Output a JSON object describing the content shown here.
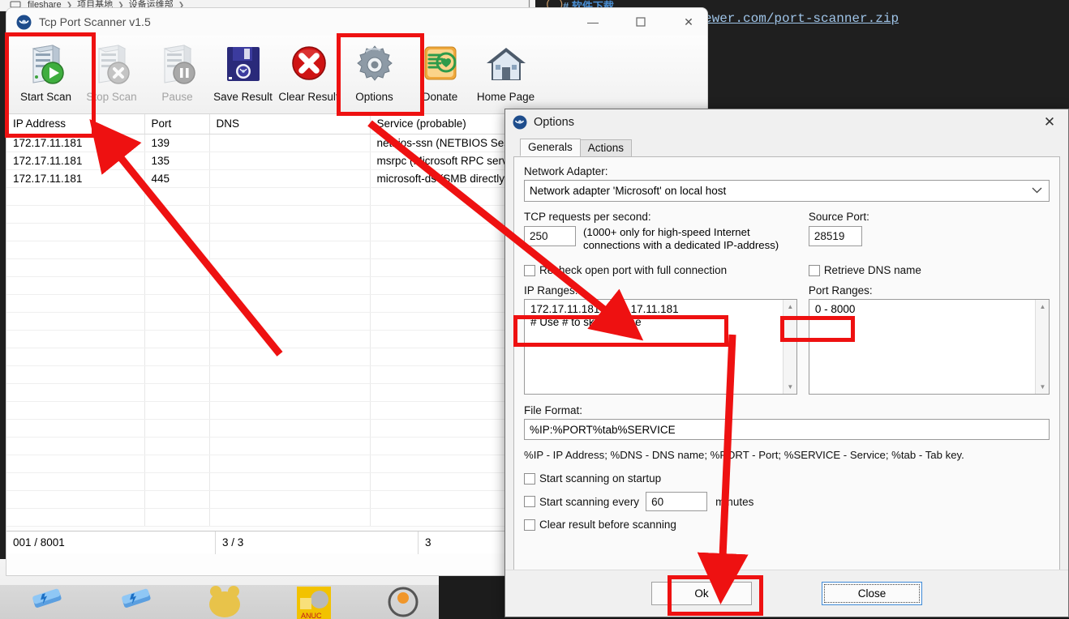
{
  "background": {
    "explorer_breadcrumb": [
      "fileshare",
      "项目基地",
      "设备运维部"
    ],
    "dark_heading_hash": "#",
    "dark_heading_text": "软件下载",
    "zip_link": "ewer.com/port-scanner.zip"
  },
  "app": {
    "title": "Tcp Port Scanner v1.5",
    "window_controls": {
      "minimize": "—",
      "maximize": "▢",
      "close": "✕"
    },
    "toolbar": [
      {
        "label": "Start Scan",
        "icon": "server-play-icon",
        "disabled": false
      },
      {
        "label": "Stop Scan",
        "icon": "server-stop-icon",
        "disabled": true
      },
      {
        "label": "Pause",
        "icon": "server-pause-icon",
        "disabled": true
      },
      {
        "label": "Save Result",
        "icon": "floppy-disk-icon",
        "disabled": false
      },
      {
        "label": "Clear Result",
        "icon": "red-x-icon",
        "disabled": false
      },
      {
        "label": "Options",
        "icon": "gear-icon",
        "disabled": false
      },
      {
        "label": "Donate",
        "icon": "donate-hand-icon",
        "disabled": false
      },
      {
        "label": "Home Page",
        "icon": "house-icon",
        "disabled": false
      }
    ],
    "table": {
      "columns": [
        "IP Address",
        "Port",
        "DNS",
        "Service (probable)"
      ],
      "rows": [
        [
          "172.17.11.181",
          "139",
          "",
          "netbios-ssn (NETBIOS Sess"
        ],
        [
          "172.17.11.181",
          "135",
          "",
          "msrpc (Microsoft RPC servi"
        ],
        [
          "172.17.11.181",
          "445",
          "",
          "microsoft-ds (SMB directly "
        ]
      ],
      "empty_rows": 19
    },
    "statusbar": {
      "progress": "001 / 8001",
      "hosts": "3 / 3",
      "count": "3"
    }
  },
  "options_dialog": {
    "title": "Options",
    "close_label": "✕",
    "tabs": [
      {
        "label": "Generals",
        "active": true
      },
      {
        "label": "Actions",
        "active": false
      }
    ],
    "network_adapter": {
      "label": "Network Adapter:",
      "value": "Network adapter 'Microsoft' on local host",
      "chevron": "⌄"
    },
    "tcp_requests": {
      "label": "TCP requests per second:",
      "value": "250",
      "note_line1": "(1000+ only for high-speed Internet",
      "note_line2": "connections with a dedicated IP-address)"
    },
    "source_port": {
      "label": "Source Port:",
      "value": "28519"
    },
    "recheck_checkbox": {
      "label": "Recheck open port with full connection",
      "checked": false
    },
    "retrieve_dns_checkbox": {
      "label": "Retrieve DNS name",
      "checked": false
    },
    "ip_ranges": {
      "label": "IP Ranges:",
      "line1": "172.17.11.181 - 172.17.11.181",
      "line2": "# Use # to skip the line"
    },
    "port_ranges": {
      "label": "Port Ranges:",
      "line1": "0 - 8000"
    },
    "file_format": {
      "label": "File Format:",
      "value": "%IP:%PORT%tab%SERVICE"
    },
    "format_hint": "%IP - IP Address; %DNS - DNS name; %PORT - Port; %SERVICE - Service; %tab - Tab key.",
    "startup_checkbox": {
      "label": "Start scanning on startup",
      "checked": false
    },
    "interval_checkbox": {
      "label": "Start scanning every",
      "checked": false,
      "value": "60",
      "suffix": "minutes"
    },
    "clear_checkbox": {
      "label": "Clear result before scanning",
      "checked": false
    },
    "buttons": {
      "ok": "Ok",
      "close": "Close"
    }
  },
  "annotations": {
    "highlight_color": "#ee1111",
    "boxes": [
      "start-scan-button",
      "options-button",
      "ip-ranges-field",
      "port-ranges-field",
      "ok-button"
    ],
    "arrows": [
      "arrow-to-start-scan",
      "arrow-to-ip-ranges",
      "arrow-to-ok-button"
    ]
  }
}
